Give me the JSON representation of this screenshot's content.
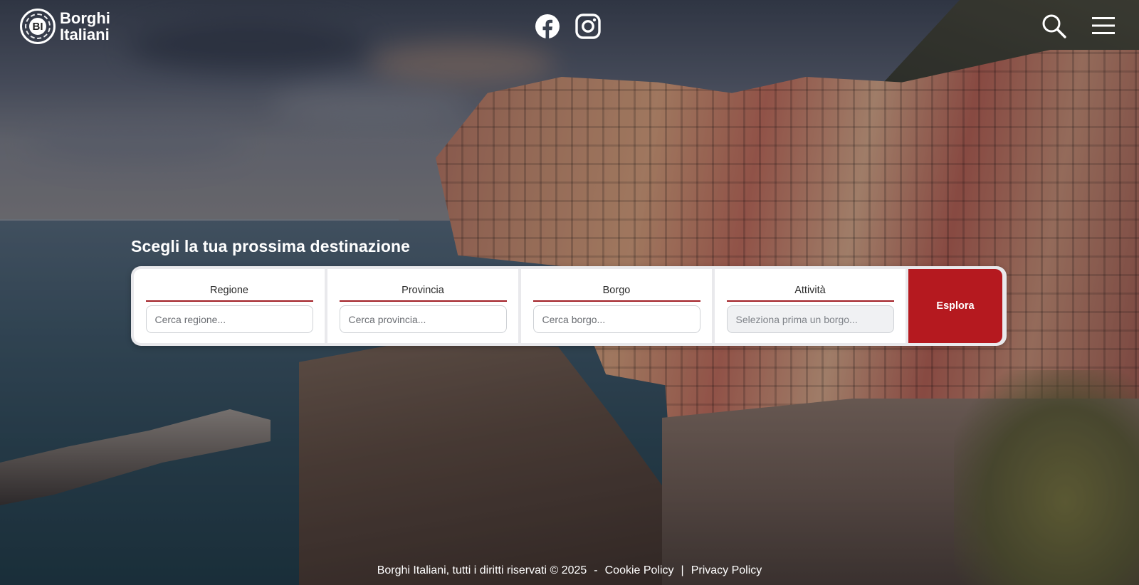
{
  "header": {
    "logo": {
      "initials": "BI",
      "line1": "Borghi",
      "line2": "Italiani"
    },
    "social": [
      {
        "icon": "facebook-icon"
      },
      {
        "icon": "instagram-icon"
      }
    ],
    "actions": [
      {
        "icon": "search-icon"
      },
      {
        "icon": "hamburger-menu-icon"
      }
    ]
  },
  "search": {
    "headline": "Scegli la tua prossima destinazione",
    "fields": [
      {
        "label": "Regione",
        "placeholder": "Cerca regione..."
      },
      {
        "label": "Provincia",
        "placeholder": "Cerca provincia..."
      },
      {
        "label": "Borgo",
        "placeholder": "Cerca borgo..."
      },
      {
        "label": "Attività",
        "placeholder": "Seleziona prima un borgo..."
      }
    ],
    "button_label": "Esplora"
  },
  "footer": {
    "copyright": "Borghi Italiani, tutti i diritti riservati © 2025",
    "dash": "-",
    "cookie_policy": "Cookie Policy",
    "separator": "|",
    "privacy_policy": "Privacy Policy"
  },
  "colors": {
    "accent": "#b5191f",
    "label_underline": "#a11e24",
    "panel_bg": "#e9e9ec"
  }
}
